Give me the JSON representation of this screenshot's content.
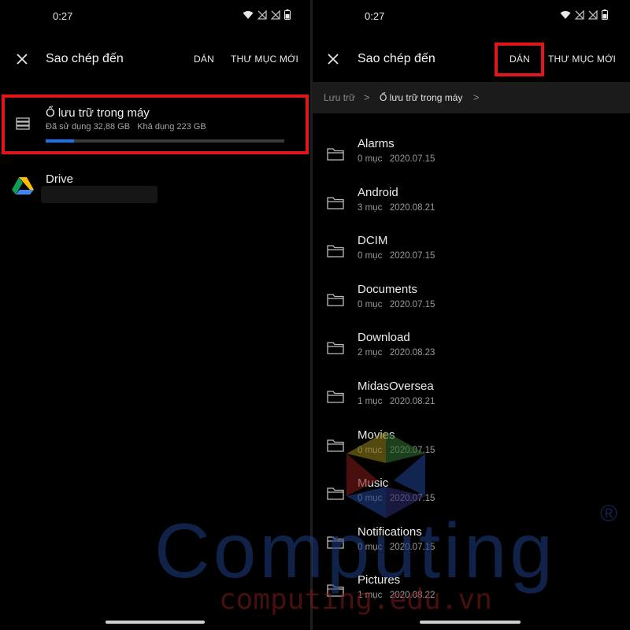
{
  "status_bar": {
    "time": "0:27"
  },
  "left_panel": {
    "title": "Sao chép đến",
    "paste_label": "DÁN",
    "new_folder_label": "THƯ MỤC MỚI",
    "storage": {
      "title": "Ổ lưu trữ trong máy",
      "used_text": "Đã sử dụng 32,88 GB   Khả dụng 223 GB",
      "used_fraction": 0.12
    },
    "drive": {
      "title": "Drive"
    }
  },
  "right_panel": {
    "title": "Sao chép đến",
    "paste_label": "DÁN",
    "new_folder_label": "THƯ MỤC MỚI",
    "breadcrumb": {
      "root": "Lưu trữ",
      "current": "Ổ lưu trữ trong máy",
      "separator": ">"
    },
    "folders": [
      {
        "name": "Alarms",
        "meta": "0 mục   2020.07.15"
      },
      {
        "name": "Android",
        "meta": "3 mục   2020.08.21"
      },
      {
        "name": "DCIM",
        "meta": "0 mục   2020.07.15"
      },
      {
        "name": "Documents",
        "meta": "0 mục   2020.07.15"
      },
      {
        "name": "Download",
        "meta": "2 mục   2020.08.23"
      },
      {
        "name": "MidasOversea",
        "meta": "1 mục   2020.08.21"
      },
      {
        "name": "Movies",
        "meta": "0 mục   2020.07.15"
      },
      {
        "name": "Music",
        "meta": "0 mục   2020.07.15"
      },
      {
        "name": "Notifications",
        "meta": "0 mục   2020.07.15"
      },
      {
        "name": "Pictures",
        "meta": "1 mục   2020.08.22"
      }
    ]
  },
  "watermark": {
    "brand": "Computing",
    "registered": "®",
    "domain": "computing.edu.vn"
  },
  "colors": {
    "highlight": "#e0161b",
    "progress": "#1a73e8",
    "background": "#000000"
  },
  "icons": [
    "close-icon",
    "storage-icon",
    "drive-icon",
    "folder-icon",
    "chevron-right-icon",
    "wifi-icon",
    "signal-icon",
    "battery-icon"
  ]
}
